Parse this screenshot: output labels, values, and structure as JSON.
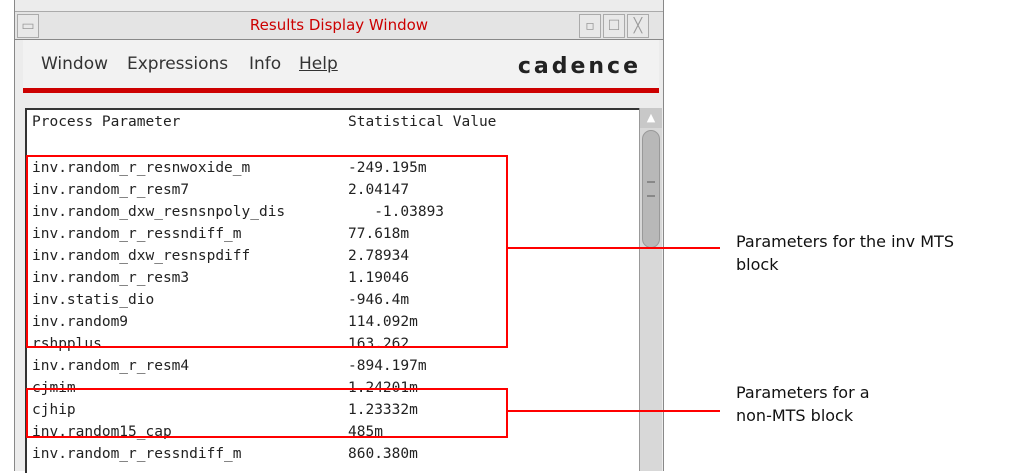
{
  "window": {
    "title": "Results Display Window",
    "menu": [
      "Window",
      "Expressions",
      "Info",
      "Help"
    ],
    "logo": "cadence"
  },
  "table": {
    "headers": [
      "Process Parameter",
      "Statistical Value"
    ],
    "rows": [
      [
        "inv.random_r_resnwoxide_m",
        "-249.195m"
      ],
      [
        "inv.random_r_resm7",
        "2.04147"
      ],
      [
        "inv.random_dxw_resnsnpoly_dis",
        "   -1.03893"
      ],
      [
        "inv.random_r_ressndiff_m",
        "77.618m"
      ],
      [
        "inv.random_dxw_resnspdiff",
        "2.78934"
      ],
      [
        "inv.random_r_resm3",
        "1.19046"
      ],
      [
        "inv.statis_dio",
        "-946.4m"
      ],
      [
        "inv.random9",
        "114.092m"
      ],
      [
        "rshpplus",
        "163.262"
      ],
      [
        "inv.random_r_resm4",
        "-894.197m"
      ],
      [
        "cjmim",
        "1.24201m"
      ],
      [
        "cjhip",
        "1.23332m"
      ],
      [
        "inv.random15_cap",
        "485m"
      ],
      [
        "inv.random_r_ressndiff_m",
        "860.380m"
      ]
    ]
  },
  "annotations": {
    "inv_block": "Parameters for the inv MTS block",
    "non_mts": "Parameters for a non-MTS block"
  },
  "colors": {
    "accent": "#cc0000",
    "highlight": "#ff0000"
  }
}
